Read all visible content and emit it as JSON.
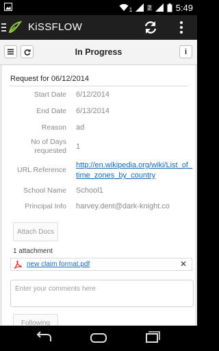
{
  "status_bar": {
    "time": "5:49",
    "signal_badge": "1",
    "data_badge": "2"
  },
  "app_bar": {
    "title": "KiSSFLOW"
  },
  "toolbar": {
    "title": "In Progress",
    "info_label": "i"
  },
  "request": {
    "title": "Request for 06/12/2014",
    "fields": [
      {
        "label": "Start Date",
        "value": "6/12/2014"
      },
      {
        "label": "End Date",
        "value": "6/13/2014"
      },
      {
        "label": "Reason",
        "value": "ad"
      },
      {
        "label": "No of Days requested",
        "value": "1"
      },
      {
        "label": "URL Reference",
        "value": "http://en.wikipedia.org/wiki/List_of_time_zones_by_country"
      },
      {
        "label": "School Name",
        "value": "School1"
      },
      {
        "label": "Principal Info",
        "value": "harvey.dent@dark-knight.co"
      }
    ]
  },
  "attachments": {
    "button_label": "Attach Docs",
    "count_text": "1 attachment",
    "items": [
      {
        "name": "new claim format.pdf",
        "remove_label": "✕"
      }
    ]
  },
  "comment": {
    "placeholder": "Enter your comments here"
  },
  "follow": {
    "button_label": "Following"
  },
  "colors": {
    "app_bar": "#1f1f1f",
    "link": "#1669b5",
    "logo": "#8dc63f",
    "pdf": "#d9261c"
  }
}
